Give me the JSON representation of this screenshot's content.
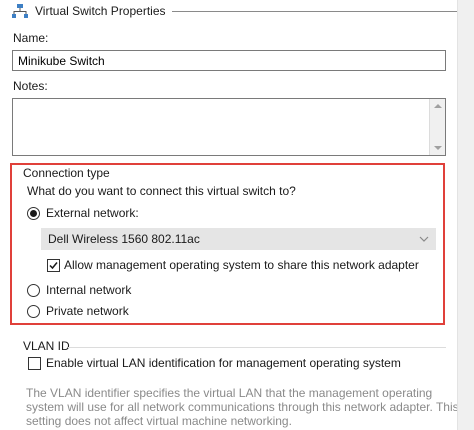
{
  "header": {
    "title": "Virtual Switch Properties",
    "icon": "network-switch-icon"
  },
  "name": {
    "label": "Name:",
    "value": "Minikube Switch",
    "placeholder": ""
  },
  "notes": {
    "label": "Notes:",
    "value": ""
  },
  "connection": {
    "group_label": "Connection type",
    "question": "What do you want to connect this virtual switch to?",
    "external": {
      "label": "External network:",
      "selected": true
    },
    "adapter": {
      "value": "Dell Wireless 1560 802.11ac"
    },
    "allow_mgmt": {
      "label": "Allow management operating system to share this network adapter",
      "checked": true
    },
    "internal": {
      "label": "Internal network",
      "selected": false
    },
    "private": {
      "label": "Private network",
      "selected": false
    },
    "highlight_color": "#e0403a"
  },
  "vlan": {
    "group_label": "VLAN ID",
    "enable": {
      "label": "Enable virtual LAN identification for management operating system",
      "checked": false
    },
    "description_lines": [
      "The VLAN identifier specifies the virtual LAN that the management operating",
      "system will use for all network communications through this network adapter. This",
      "setting does not affect virtual machine networking."
    ]
  }
}
